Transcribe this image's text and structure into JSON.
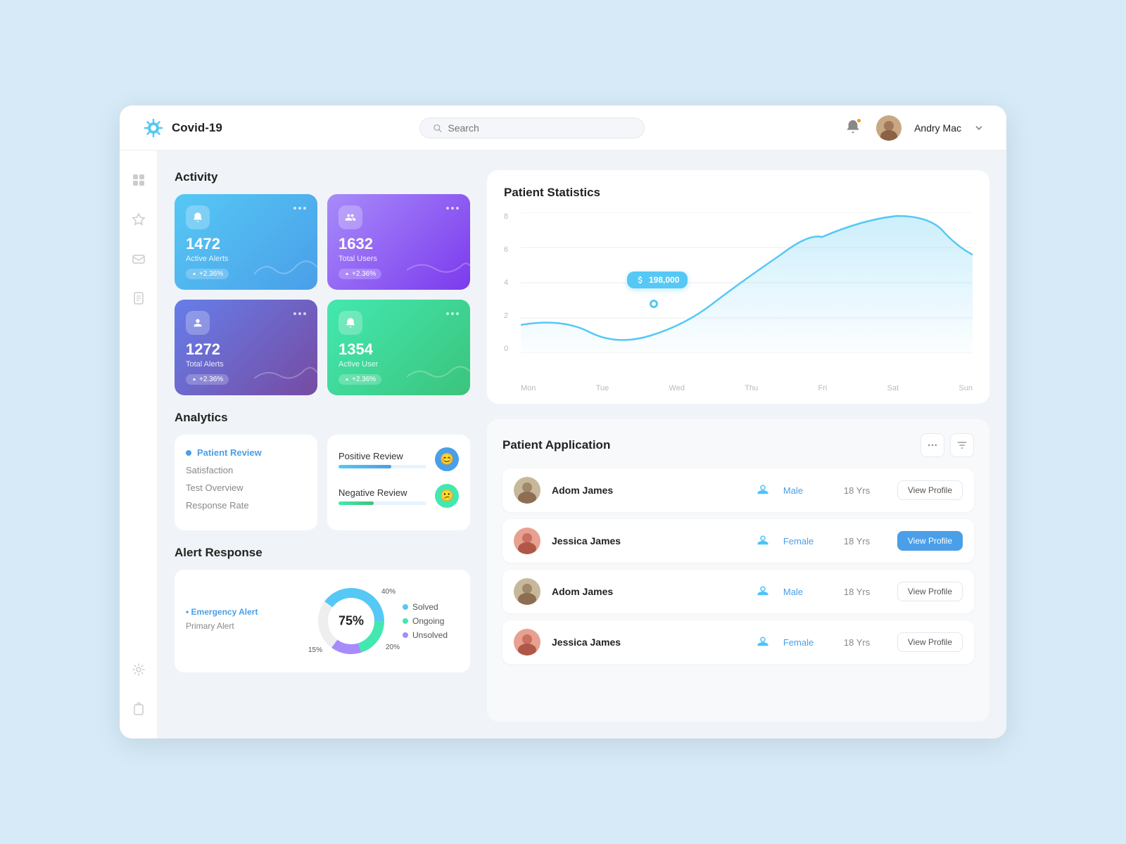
{
  "app": {
    "title": "Covid-19",
    "search_placeholder": "Search"
  },
  "user": {
    "name": "Andry Mac"
  },
  "activity": {
    "title": "Activity",
    "cards": [
      {
        "value": "1472",
        "label": "Active Alerts",
        "badge": "+2.36%",
        "color": "blue"
      },
      {
        "value": "1632",
        "label": "Total Users",
        "badge": "+2.36%",
        "color": "purple"
      },
      {
        "value": "1272",
        "label": "Total Alerts",
        "badge": "+2.36%",
        "color": "indigo"
      },
      {
        "value": "1354",
        "label": "Active User",
        "badge": "+2.36%",
        "color": "green"
      }
    ]
  },
  "analytics": {
    "title": "Analytics",
    "left_items": [
      {
        "label": "Patient Review",
        "active": true
      },
      {
        "label": "Satisfaction",
        "active": false
      },
      {
        "label": "Test Overview",
        "active": false
      },
      {
        "label": "Response Rate",
        "active": false
      }
    ],
    "reviews": [
      {
        "label": "Positive Review",
        "fill": 60,
        "icon": "😊",
        "color": "#4a9fe8",
        "icon_bg": "blue"
      },
      {
        "label": "Negative Review",
        "fill": 40,
        "icon": "😕",
        "color": "#43e8b0",
        "icon_bg": "green"
      }
    ]
  },
  "alert_response": {
    "title": "Alert Response",
    "center_pct": "75%",
    "legend_left": [
      {
        "label": "Emergency Alert",
        "active": true
      },
      {
        "label": "Primary Alert",
        "active": false
      }
    ],
    "segments": [
      {
        "label": "Solved",
        "pct": "40%",
        "color": "#56c8f5",
        "value": 40
      },
      {
        "label": "Ongoing",
        "pct": "20%",
        "color": "#43e8b0",
        "value": 20
      },
      {
        "label": "Unsolved",
        "pct": "15%",
        "color": "#a78bfa",
        "value": 15
      }
    ],
    "donut_labels": [
      {
        "pct": "40%",
        "angle": -50
      },
      {
        "pct": "20%",
        "angle": 40
      },
      {
        "pct": "15%",
        "angle": 160
      }
    ]
  },
  "patient_statistics": {
    "title": "Patient Statistics",
    "tooltip": "198,000",
    "x_labels": [
      "Mon",
      "Tue",
      "Wed",
      "Thu",
      "Fri",
      "Sat",
      "Sun"
    ],
    "y_labels": [
      "8",
      "6",
      "4",
      "2",
      "0"
    ]
  },
  "patient_application": {
    "title": "Patient Application",
    "patients": [
      {
        "name": "Adom James",
        "gender": "Male",
        "age": "18 Yrs",
        "primary": false
      },
      {
        "name": "Jessica James",
        "gender": "Female",
        "age": "18 Yrs",
        "primary": true
      },
      {
        "name": "Adom James",
        "gender": "Male",
        "age": "18 Yrs",
        "primary": false
      },
      {
        "name": "Jessica James",
        "gender": "Female",
        "age": "18 Yrs",
        "primary": false
      }
    ],
    "view_profile_label": "View Profile"
  }
}
